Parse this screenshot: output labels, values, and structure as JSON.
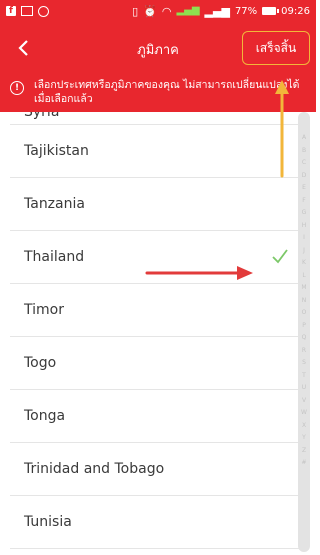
{
  "status_bar": {
    "battery": "77%",
    "time": "09:26"
  },
  "header": {
    "title": "ภูมิภาค",
    "done_label": "เสร็จสิ้น"
  },
  "notice": {
    "text": "เลือกประเทศหรือภูมิภาคของคุณ ไม่สามารถเปลี่ยนแปลงได้เมื่อเลือกแล้ว"
  },
  "countries": [
    {
      "label": "Syria",
      "selected": false
    },
    {
      "label": "Tajikistan",
      "selected": false
    },
    {
      "label": "Tanzania",
      "selected": false
    },
    {
      "label": "Thailand",
      "selected": true
    },
    {
      "label": "Timor",
      "selected": false
    },
    {
      "label": "Togo",
      "selected": false
    },
    {
      "label": "Tonga",
      "selected": false
    },
    {
      "label": "Trinidad and Tobago",
      "selected": false
    },
    {
      "label": "Tunisia",
      "selected": false
    }
  ],
  "index_letters": [
    "A",
    "B",
    "C",
    "D",
    "E",
    "F",
    "G",
    "H",
    "I",
    "J",
    "K",
    "L",
    "M",
    "N",
    "O",
    "P",
    "Q",
    "R",
    "S",
    "T",
    "U",
    "V",
    "W",
    "X",
    "Y",
    "Z",
    "#"
  ],
  "colors": {
    "primary": "#e8272e",
    "check": "#7cc868",
    "annotation_arrow": "#e23b3b",
    "highlight": "#f2b63a"
  }
}
